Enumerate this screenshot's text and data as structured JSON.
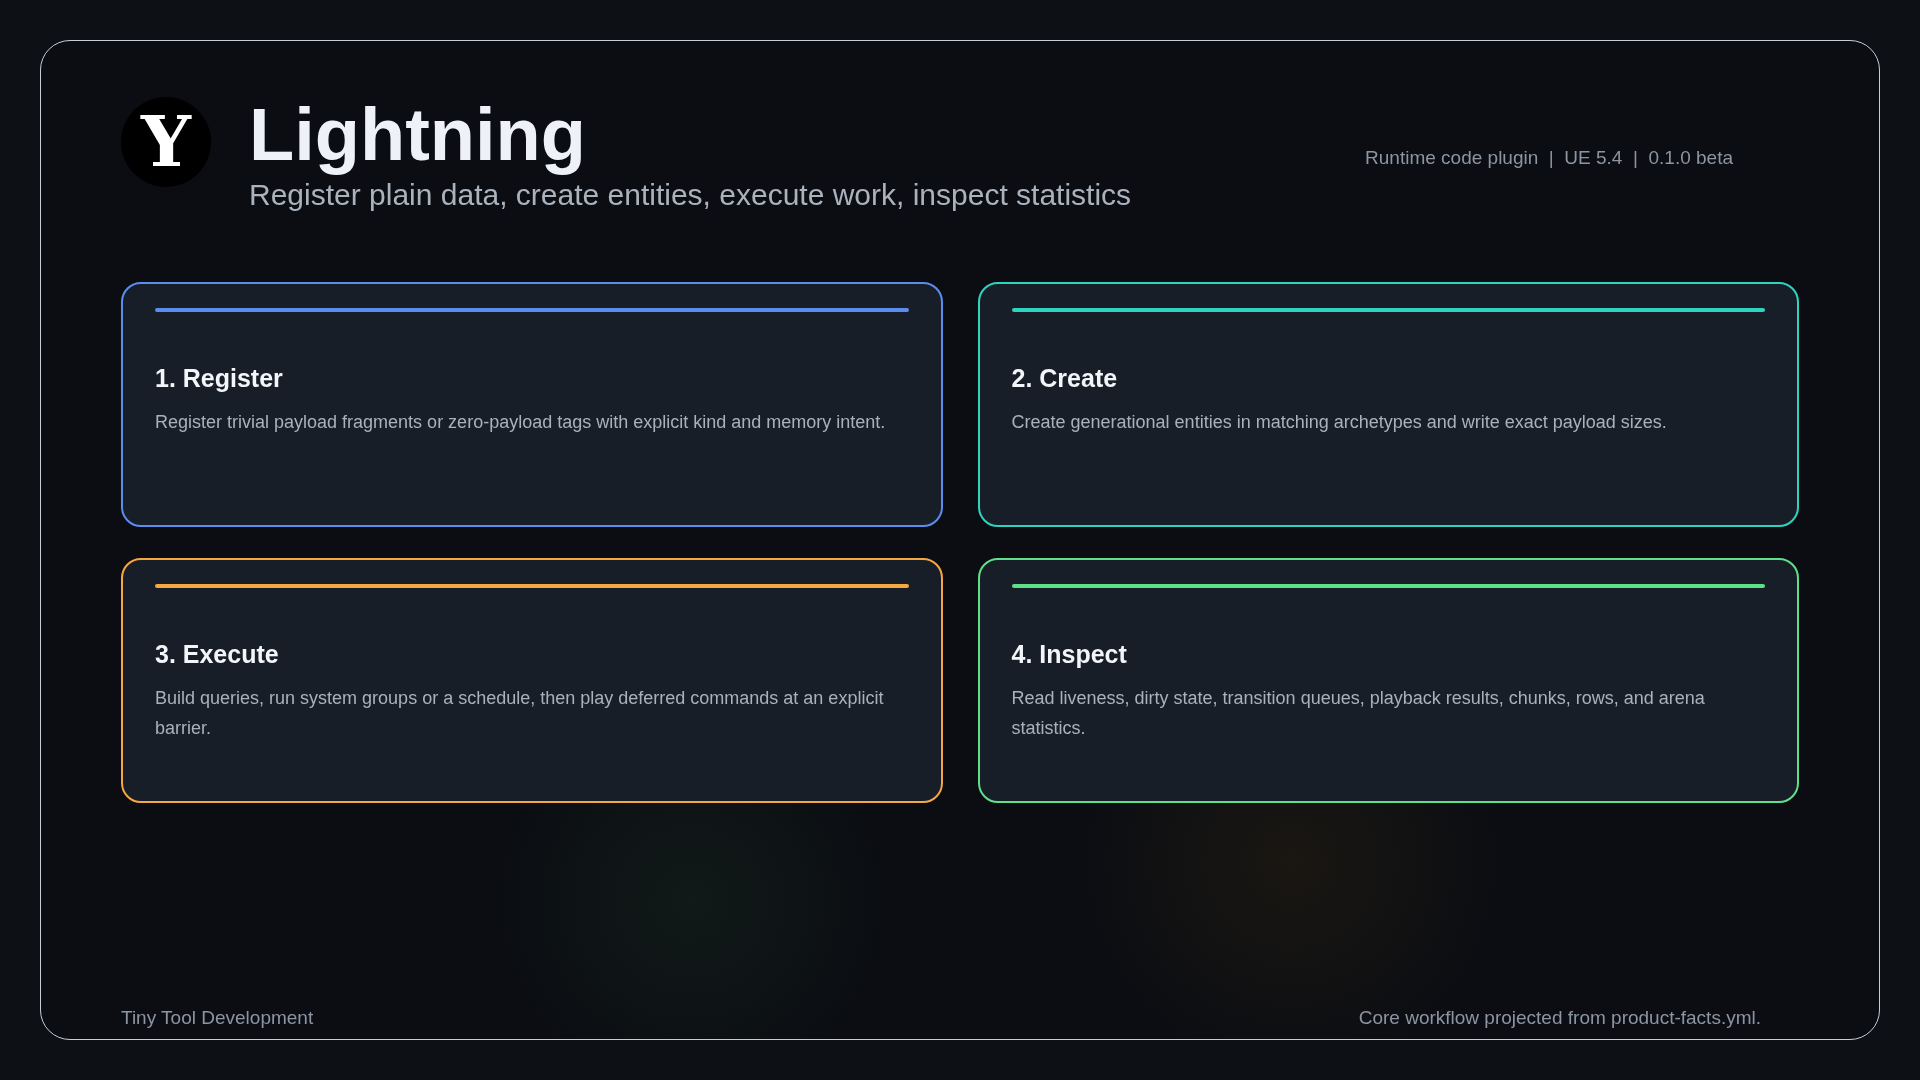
{
  "header": {
    "logo_letter": "Y",
    "title": "Lightning",
    "subtitle": "Register plain data, create entities, execute work, inspect statistics",
    "meta": "Runtime code plugin  |  UE 5.4  |  0.1.0 beta"
  },
  "cards": [
    {
      "title": "1. Register",
      "description": "Register trivial payload fragments or zero-payload tags with explicit kind and memory intent.",
      "color": "#5b8def"
    },
    {
      "title": "2. Create",
      "description": "Create generational entities in matching archetypes and write exact payload sizes.",
      "color": "#2dd4bf"
    },
    {
      "title": "3. Execute",
      "description": "Build queries, run system groups or a schedule, then play deferred commands at an explicit barrier.",
      "color": "#f5a742"
    },
    {
      "title": "4. Inspect",
      "description": "Read liveness, dirty state, transition queues, playback results, chunks, rows, and arena statistics.",
      "color": "#5ee08a"
    }
  ],
  "footer": {
    "left": "Tiny Tool Development",
    "right": "Core workflow projected from product-facts.yml."
  }
}
